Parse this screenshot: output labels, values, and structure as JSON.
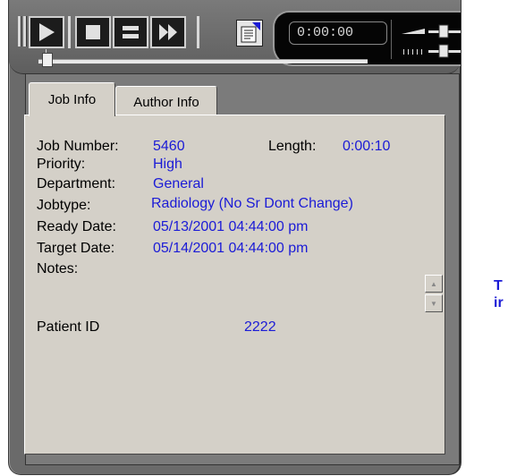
{
  "player": {
    "time_display": "0:00:00",
    "position_fraction": 0.01,
    "icons": [
      "play-icon",
      "stop-icon",
      "pause-icon",
      "fast-forward-icon",
      "properties-icon",
      "volume-icon",
      "speed-icon"
    ]
  },
  "tabs": [
    {
      "label": "Job Info",
      "active": true
    },
    {
      "label": "Author Info",
      "active": false
    }
  ],
  "job": {
    "job_number_label": "Job Number:",
    "job_number": "5460",
    "length_label": "Length:",
    "length": "0:00:10",
    "priority_label": "Priority:",
    "priority": "High",
    "department_label": "Department:",
    "department": "General",
    "jobtype_label": "Jobtype:",
    "jobtype": "Radiology (No Sr Dont Change)",
    "ready_date_label": "Ready Date:",
    "ready_date": "05/13/2001 04:44:00 pm",
    "target_date_label": "Target Date:",
    "target_date": "05/14/2001 04:44:00 pm",
    "notes_label": "Notes:",
    "patient_id_label": "Patient ID",
    "patient_id": "2222"
  },
  "side_text": [
    "T",
    "ir"
  ],
  "colors": {
    "value_text": "#1b1bd6",
    "panel": "#d4d0c8",
    "frame": "#6a6a6a"
  }
}
